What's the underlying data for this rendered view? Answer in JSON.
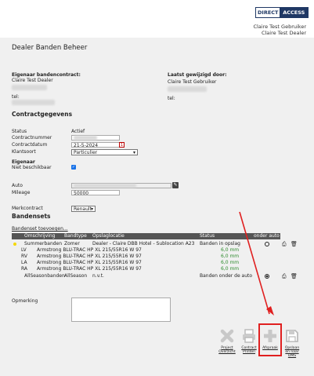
{
  "brand": {
    "part1": "DIRECT",
    "part2": "ACCESS"
  },
  "user": {
    "name": "Claire Test Gebruiker",
    "dealer": "Claire Test Dealer"
  },
  "page": {
    "title": "Dealer Banden Beheer"
  },
  "owner": {
    "heading": "Eigenaar bandencontract:",
    "name": "Claire Test Dealer",
    "tel_label": "tel:"
  },
  "modified": {
    "heading": "Laatst gewijzigd door:",
    "name": "Claire Test Gebruiker",
    "tel_label": "tel:"
  },
  "contract": {
    "heading": "Contractgegevens",
    "status_label": "Status",
    "status_value": "Actief",
    "number_label": "Contractnummer",
    "date_label": "Contractdatum",
    "date_value": "21-5-2024",
    "type_label": "Klantsoort",
    "type_value": "Particulier",
    "owner_label": "Eigenaar",
    "unavailable_label": "Niet beschikbaar",
    "car_label": "Auto",
    "mileage_label": "Mileage",
    "mileage_value": "50000",
    "brand_label": "Merkcontract",
    "brand_value": "Renault"
  },
  "tiresets": {
    "heading": "Bandensets",
    "add_link": "Bandenset toevoegen...",
    "columns": [
      "Omschrijving",
      "Bandtype",
      "Opslaglocatie",
      "Status",
      "onder auto"
    ],
    "set1": {
      "name": "Summerbanden",
      "type": "Zomer",
      "location": "Dealer - Claire DBB Hotel - Sublocation A23",
      "status": "Banden in opslag"
    },
    "tires": [
      {
        "pos": "LV",
        "spec": "Armstrong BLU-TRAC HP XL 215/55R16 W 97",
        "depth": "6,0 mm"
      },
      {
        "pos": "RV",
        "spec": "Armstrong BLU-TRAC HP XL 215/55R16 W 97",
        "depth": "6,0 mm"
      },
      {
        "pos": "LA",
        "spec": "Armstrong BLU-TRAC HP XL 215/55R16 W 97",
        "depth": "6,0 mm"
      },
      {
        "pos": "RA",
        "spec": "Armstrong BLU-TRAC HP XL 215/55R16 W 97",
        "depth": "6,0 mm"
      }
    ],
    "set2": {
      "name": "AllSeasonbanden",
      "type": "AllSeason",
      "location": "n.v.t.",
      "status": "Banden onder de auto"
    }
  },
  "remark": {
    "label": "Opmerking"
  },
  "actions": {
    "project": "Project Overzicht",
    "print": "Contract Printen",
    "afspraak": "Afspraak",
    "save": "Opslaan en naar DMS"
  },
  "colors": {
    "accent": "#1f3864",
    "highlight": "#e02020",
    "green": "#2e8b2e"
  }
}
